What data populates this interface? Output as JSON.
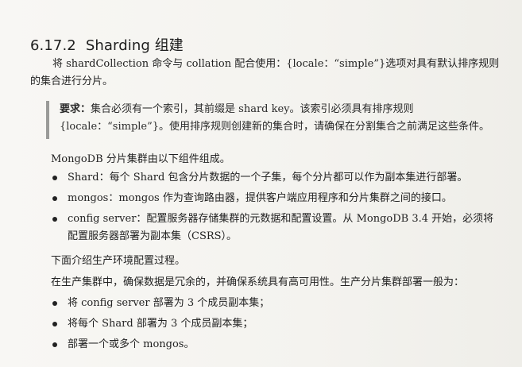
{
  "heading": {
    "number": "6.17.2",
    "title": "Sharding 组建"
  },
  "paragraphs": {
    "intro": "将 shardCollection 命令与 collation 配合使用：{locale：“simple”}选项对具有默认排序规则的集合进行分片。",
    "components_intro": "MongoDB 分片集群由以下组件组成。",
    "production_intro": "下面介绍生产环境配置过程。",
    "production_detail": "在生产集群中，确保数据是冗余的，并确保系统具有高可用性。生产分片集群部署一般为："
  },
  "note": {
    "label": "要求：",
    "text": "集合必须有一个索引，其前缀是 shard key。该索引必须具有排序规则{locale：“simple”}。使用排序规则创建新的集合时，请确保在分割集合之前满足这些条件。"
  },
  "component_list": [
    "Shard：每个 Shard 包含分片数据的一个子集，每个分片都可以作为副本集进行部署。",
    "mongos：mongos 作为查询路由器，提供客户端应用程序和分片集群之间的接口。",
    "config server：配置服务器存储集群的元数据和配置设置。从 MongoDB 3.4 开始，必须将配置服务器部署为副本集（CSRS）。"
  ],
  "deployment_list": [
    "将 config server 部署为 3 个成员副本集；",
    "将每个 Shard 部署为 3 个成员副本集；",
    "部署一个或多个 mongos。"
  ]
}
